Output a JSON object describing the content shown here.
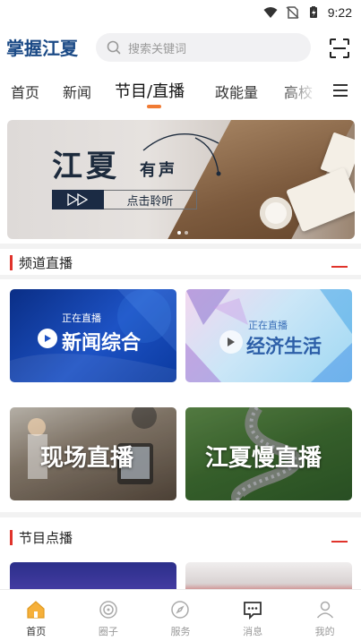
{
  "status_bar": {
    "time": "9:22"
  },
  "header": {
    "logo": "掌握江夏",
    "search_placeholder": "搜索关键词"
  },
  "nav": {
    "tabs": [
      {
        "label": "首页"
      },
      {
        "label": "新闻"
      },
      {
        "label": "节目/直播"
      },
      {
        "label": "政能量"
      },
      {
        "label": "高校"
      }
    ],
    "active_index": 2
  },
  "banner": {
    "title": "江夏",
    "subtitle": "有声",
    "button": "点击聆听"
  },
  "sections": {
    "channel_live": {
      "title": "频道直播",
      "cards": [
        {
          "tag": "正在直播",
          "label": "新闻综合"
        },
        {
          "tag": "正在直播",
          "label": "经济生活"
        },
        {
          "label": "现场直播"
        },
        {
          "label": "江夏慢直播"
        }
      ]
    },
    "on_demand": {
      "title": "节目点播"
    }
  },
  "bottom_nav": {
    "items": [
      {
        "label": "首页",
        "icon": "home-icon"
      },
      {
        "label": "圈子",
        "icon": "circle-icon"
      },
      {
        "label": "服务",
        "icon": "compass-icon"
      },
      {
        "label": "消息",
        "icon": "message-icon"
      },
      {
        "label": "我的",
        "icon": "user-icon"
      }
    ],
    "active_index": 0
  },
  "colors": {
    "accent_orange": "#f07b34",
    "accent_red": "#e0332b",
    "logo_blue": "#1b4a86",
    "home_icon_fill": "#f6b03a"
  }
}
